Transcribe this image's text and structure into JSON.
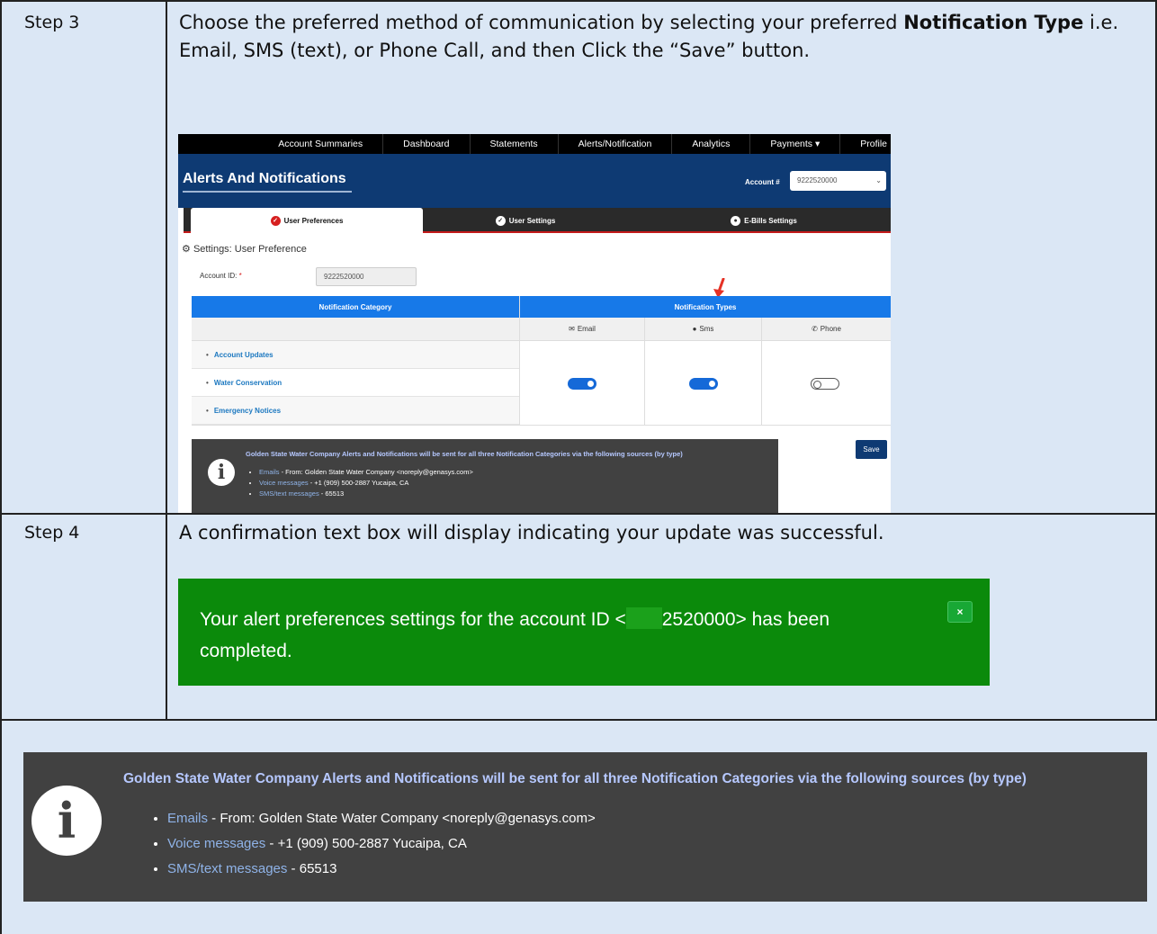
{
  "rows": [
    {
      "label": "Step 3",
      "text_before": "Choose the preferred method of communication by selecting your preferred ",
      "text_bold": "Notification Type",
      "text_after": " i.e. Email, SMS (text), or Phone Call, and then Click the “Save” button."
    },
    {
      "label": "Step 4",
      "text": "A confirmation text box will display indicating your update was successful."
    }
  ],
  "screenshot": {
    "nav": [
      "Account Summaries",
      "Dashboard",
      "Statements",
      "Alerts/Notification",
      "Analytics",
      "Payments ▾",
      "Profile"
    ],
    "page_title": "Alerts And Notifications",
    "account_label": "Account #",
    "account_value": "9222520000",
    "tabs": [
      "User Preferences",
      "User Settings",
      "E-Bills Settings"
    ],
    "settings_heading": "Settings: User Preference",
    "account_id_label": "Account ID:",
    "account_id_required": "*",
    "account_id_value": "9222520000",
    "category_header": "Notification Category",
    "types_header": "Notification Types",
    "type_columns": [
      "Email",
      "Sms",
      "Phone"
    ],
    "categories": [
      "Account Updates",
      "Water Conservation",
      "Emergency Notices"
    ],
    "toggles": {
      "email": true,
      "sms": true,
      "phone": false
    },
    "save_label": "Save",
    "info_title": "Golden State Water Company Alerts and Notifications will be sent for all three Notification Categories via the following sources (by type)",
    "info_items": [
      {
        "link": "Emails",
        "text": " - From: Golden State Water Company <noreply@genasys.com>"
      },
      {
        "link": "Voice messages",
        "text": " - +1 (909) 500-2887 Yucaipa, CA"
      },
      {
        "link": "SMS/text messages",
        "text": " - 65513"
      }
    ]
  },
  "confirmation": {
    "text_before": "Your alert preferences settings for the account ID <",
    "text_after": "2520000> has been completed.",
    "close_glyph": "×",
    "color": "#0b8a0b"
  },
  "info_box": {
    "title": "Golden State Water Company Alerts and Notifications will be sent for all three Notification Categories via the following sources (by type)",
    "items": [
      {
        "link": "Emails",
        "text": " - From: Golden State Water Company <noreply@genasys.com>"
      },
      {
        "link": "Voice messages",
        "text": " - +1 (909) 500-2887 Yucaipa, CA"
      },
      {
        "link": "SMS/text messages",
        "text": " - 65513"
      }
    ],
    "icon": "info-icon"
  }
}
